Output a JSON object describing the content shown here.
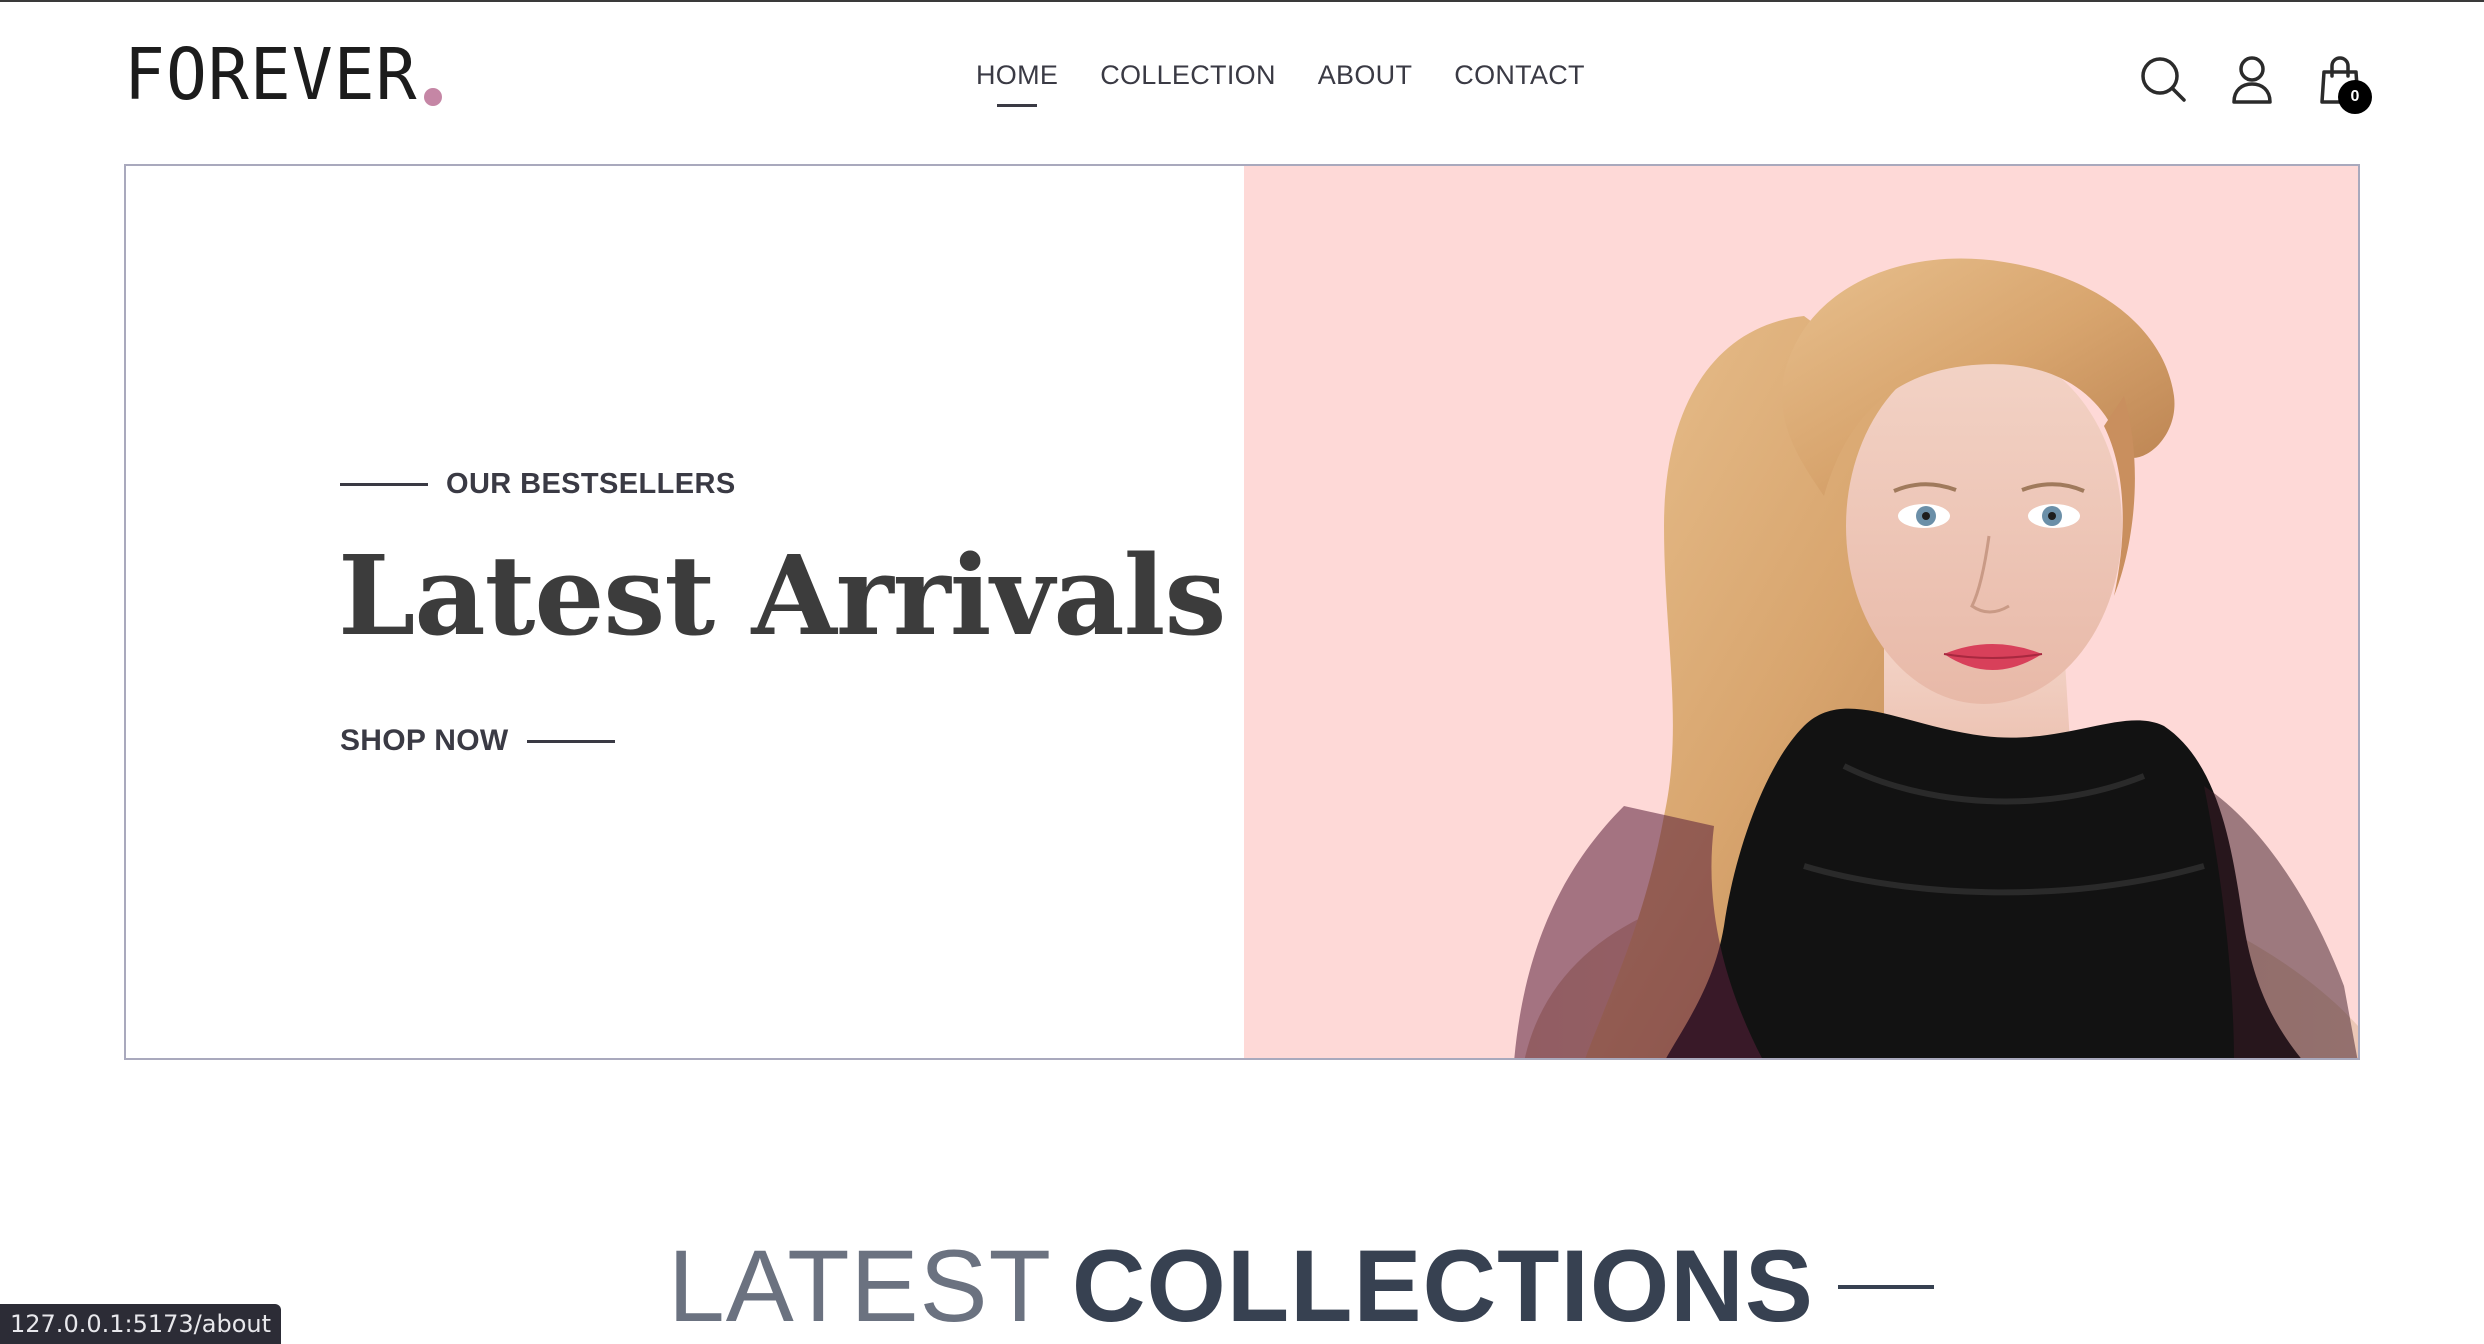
{
  "brand": {
    "name": "FOREVER",
    "dot_color": "#c586a5"
  },
  "nav": {
    "items": [
      {
        "label": "HOME",
        "active": true
      },
      {
        "label": "COLLECTION",
        "active": false
      },
      {
        "label": "ABOUT",
        "active": false
      },
      {
        "label": "CONTACT",
        "active": false
      }
    ]
  },
  "header_icons": {
    "search": "search-icon",
    "profile": "user-icon",
    "cart": "shopping-bag-icon",
    "cart_count": "0"
  },
  "hero": {
    "eyebrow": "OUR BESTSELLERS",
    "title": "Latest Arrivals",
    "cta": "SHOP NOW",
    "image_bg": "#fed9d7"
  },
  "section": {
    "title_light": "LATEST",
    "title_dark": "COLLECTIONS"
  },
  "status_bar": {
    "url": "127.0.0.1:5173/about"
  }
}
